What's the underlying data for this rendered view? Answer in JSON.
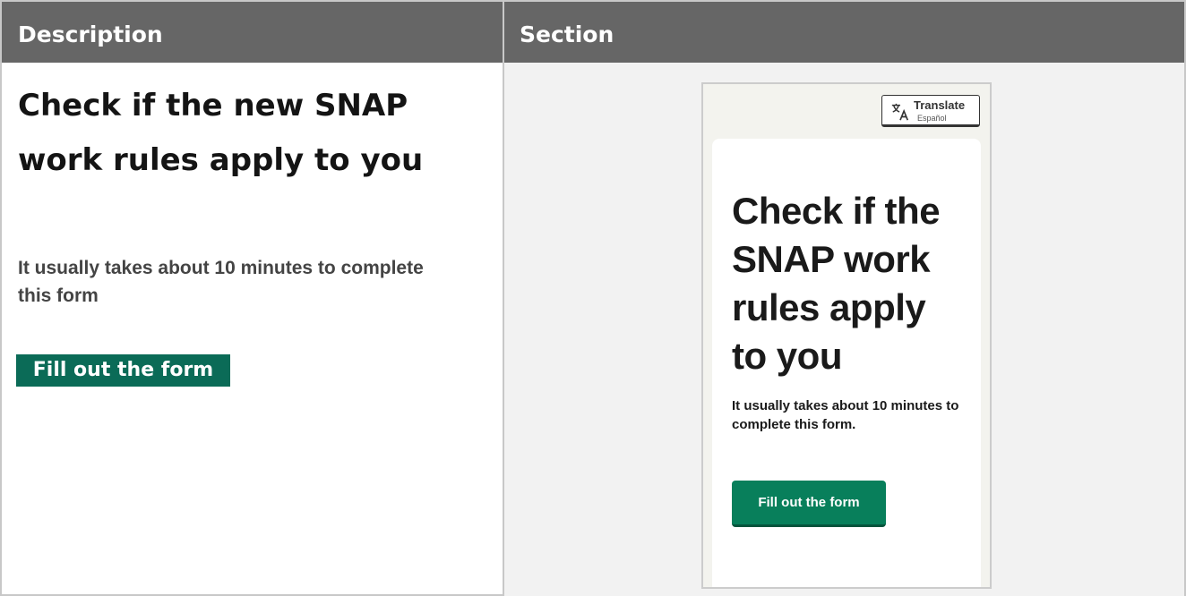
{
  "table": {
    "headers": [
      "Description",
      "Section"
    ]
  },
  "description": {
    "title": "Check if the new SNAP work rules apply to you",
    "subtitle": "It usually takes about 10 minutes to complete this form",
    "button_label": "Fill out the form"
  },
  "section_preview": {
    "translate_button": {
      "label": "Translate",
      "language": "Español",
      "icon": "translate-icon"
    },
    "title": "Check if the SNAP work rules apply to you",
    "subtitle": "It usually takes about 10 minutes to complete this form.",
    "button_label": "Fill out the form"
  },
  "colors": {
    "header_background": "#666666",
    "left_button": "#0b6b57",
    "preview_button": "#087f5b"
  }
}
